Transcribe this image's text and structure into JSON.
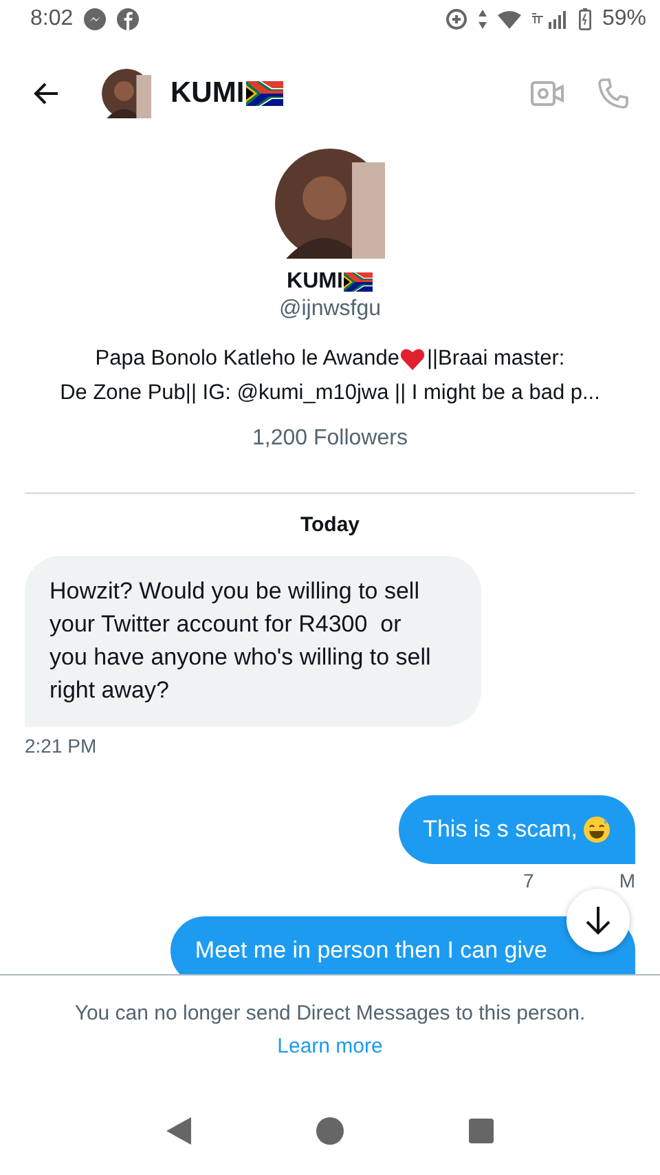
{
  "status_bar": {
    "time": "8:02",
    "battery": "59%"
  },
  "header": {
    "name": "KUMI"
  },
  "profile": {
    "name": "KUMI",
    "handle": "@ijnwsfgu",
    "bio_start": "Papa Bonolo Katleho le Awande",
    "bio_middle": "||Braai master:",
    "bio_end": "De Zone Pub|| IG: @kumi_m10jwa || I might be a bad p...",
    "followers": "1,200 Followers"
  },
  "day_label": "Today",
  "messages": [
    {
      "kind": "incoming",
      "text": "Howzit? Would you be willing to sell your Twitter account for R4300  or you have anyone who's willing to sell right away?",
      "time": "2:21 PM"
    },
    {
      "kind": "outgoing",
      "text": "This is s scam,",
      "emoji": true,
      "time_start": "7",
      "time_end": "M"
    },
    {
      "kind": "outgoing",
      "text": "Meet me in person then I can give"
    }
  ],
  "footer": {
    "notice": "You can no longer send Direct Messages to this person.",
    "link": "Learn more"
  }
}
